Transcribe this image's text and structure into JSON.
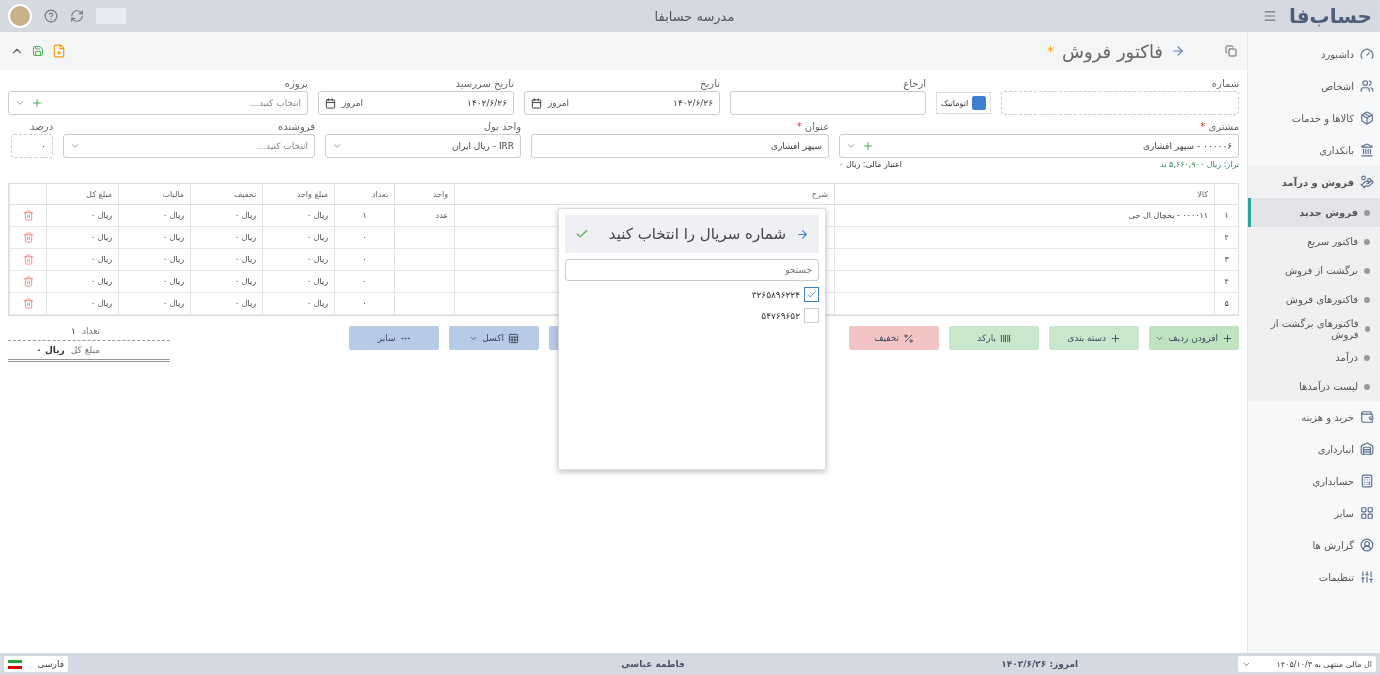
{
  "header": {
    "logo": "حساب‌فا",
    "title": "مدرسه حسابفا"
  },
  "sidebar": {
    "items": [
      {
        "label": "داشبورد",
        "selected": false
      },
      {
        "label": "اشخاص",
        "selected": false
      },
      {
        "label": "کالاها و خدمات",
        "selected": false
      },
      {
        "label": "بانکداری",
        "selected": false
      },
      {
        "label": "فروش و درآمد",
        "selected": false,
        "expanded": true,
        "children": [
          {
            "label": "فروش جدید",
            "selected": true
          },
          {
            "label": "فاکتور سریع",
            "selected": false
          },
          {
            "label": "برگشت از فروش",
            "selected": false
          },
          {
            "label": "فاکتورهای فروش",
            "selected": false
          },
          {
            "label": "فاکتورهای برگشت از فروش",
            "selected": false
          },
          {
            "label": "درآمد",
            "selected": false
          },
          {
            "label": "لیست درآمدها",
            "selected": false
          }
        ]
      },
      {
        "label": "خرید و هزینه",
        "selected": false
      },
      {
        "label": "انبارداری",
        "selected": false
      },
      {
        "label": "حسابداری",
        "selected": false
      },
      {
        "label": "سایر",
        "selected": false
      },
      {
        "label": "گزارش ها",
        "selected": false
      },
      {
        "label": "تنظیمات",
        "selected": false
      }
    ]
  },
  "page": {
    "title": "فاکتور فروش",
    "unsaved_mark": "*"
  },
  "form": {
    "number": {
      "label": "شماره",
      "auto_label": "اتوماتیک",
      "auto_checked": true
    },
    "reference": {
      "label": "ارجاع"
    },
    "date": {
      "label": "تاریخ",
      "value": "۱۴۰۲/۶/۲۶",
      "today": "امروز"
    },
    "due_date": {
      "label": "تاریخ سررسید",
      "value": "۱۴۰۲/۶/۲۶",
      "today": "امروز"
    },
    "project": {
      "label": "پروژه",
      "placeholder": "انتخاب کنید..."
    },
    "customer": {
      "label": "مشتری",
      "required": "*",
      "value": "۰۰۰۰۰۶ - سپهر افشاری",
      "balance": "تراز: ریال ۵,۶۶۰,۹۰۰ بد",
      "credit": "اعتبار مالی: ریال ۰"
    },
    "subject": {
      "label": "عنوان",
      "required": "*",
      "value": "سپهر افشاری"
    },
    "currency": {
      "label": "واحد پول",
      "value": "IRR - ریال ایران"
    },
    "seller": {
      "label": "فروشنده",
      "placeholder": "انتخاب کنید..."
    },
    "percent": {
      "label": "درصد",
      "value": "۰"
    }
  },
  "table": {
    "columns": [
      "",
      "کالا",
      "شرح",
      "واحد",
      "تعداد",
      "مبلغ واحد",
      "تخفیف",
      "مالیات",
      "مبلغ کل"
    ],
    "rows": [
      [
        "۱",
        "۰۰۰۰۱۱ - یخچال ال جی",
        "",
        "عدد",
        "۱",
        "ریال ۰",
        "ریال ۰",
        "ریال ۰",
        "ریال ۰"
      ],
      [
        "۲",
        "",
        "",
        "",
        "۰",
        "ریال ۰",
        "ریال ۰",
        "ریال ۰",
        "ریال ۰"
      ],
      [
        "۳",
        "",
        "",
        "",
        "۰",
        "ریال ۰",
        "ریال ۰",
        "ریال ۰",
        "ریال ۰"
      ],
      [
        "۴",
        "",
        "",
        "",
        "۰",
        "ریال ۰",
        "ریال ۰",
        "ریال ۰",
        "ریال ۰"
      ],
      [
        "۵",
        "",
        "",
        "",
        "۰",
        "ریال ۰",
        "ریال ۰",
        "ریال ۰",
        "ریال ۰"
      ]
    ]
  },
  "actions": [
    {
      "label": "افزودن ردیف",
      "kind": "add",
      "color": "#bfe3c1",
      "caret": true
    },
    {
      "label": "دسته بندی",
      "kind": "add",
      "color": "#c9e8cb",
      "caret": false
    },
    {
      "label": "بارکد",
      "kind": "barcode",
      "color": "#c9e8cb",
      "caret": false
    },
    {
      "label": "تخفیف",
      "kind": "percent",
      "color": "#f4c4c4",
      "caret": false
    },
    {
      "kind": "blank",
      "color": "#b7cbe6",
      "caret": false
    },
    {
      "label": "اکسل",
      "kind": "excel",
      "color": "#b7cbe6",
      "caret": true
    },
    {
      "label": "سایر",
      "kind": "more",
      "color": "#b7cbe6",
      "caret": false
    }
  ],
  "summary": {
    "count_label": "تعداد",
    "count": "۱",
    "total_label": "مبلغ کل",
    "total": "ریال ۰"
  },
  "dialog": {
    "title": "شماره سریال را انتخاب کنید",
    "search_placeholder": "جستجو",
    "serials": [
      {
        "value": "۳۲۶۵۸۹۶۲۲۴",
        "checked": true
      },
      {
        "value": "۵۴۷۶۹۶۵۲",
        "checked": false
      }
    ]
  },
  "status_bar": {
    "fiscal_year": "ال مالی منتهی به ۱۴۰۵/۱۰/۳",
    "today": "امروز: ۱۴۰۲/۶/۲۶",
    "user": "فاطمه عباسی",
    "language": "فارسی"
  }
}
